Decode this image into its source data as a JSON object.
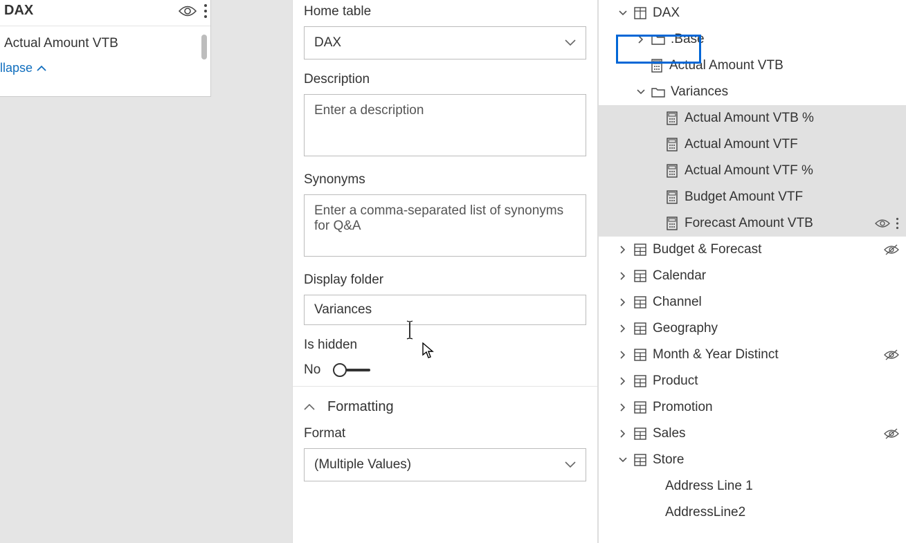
{
  "left": {
    "title": "DAX",
    "item": "Actual Amount VTB",
    "collapse": "llapse"
  },
  "center": {
    "homeTableLabel": "Home table",
    "homeTableValue": "DAX",
    "descriptionLabel": "Description",
    "descriptionPlaceholder": "Enter a description",
    "synonymsLabel": "Synonyms",
    "synonymsPlaceholder": "Enter a comma-separated list of synonyms for Q&A",
    "displayFolderLabel": "Display folder",
    "displayFolderValue": "Variances",
    "isHiddenLabel": "Is hidden",
    "isHiddenValue": "No",
    "formattingLabel": "Formatting",
    "formatLabel": "Format",
    "formatValue": "(Multiple Values)"
  },
  "tree": {
    "dax": "DAX",
    "base": ".Base",
    "measure1": "Actual Amount VTB",
    "varFolder": "Variances",
    "varItems": [
      "Actual Amount VTB %",
      "Actual Amount VTF",
      "Actual Amount VTF %",
      "Budget Amount VTF",
      "Forecast Amount VTB"
    ],
    "tables": [
      "Budget & Forecast",
      "Calendar",
      "Channel",
      "Geography",
      "Month & Year Distinct",
      "Product",
      "Promotion",
      "Sales",
      "Store"
    ],
    "storeCols": [
      "Address Line 1",
      "AddressLine2"
    ]
  }
}
